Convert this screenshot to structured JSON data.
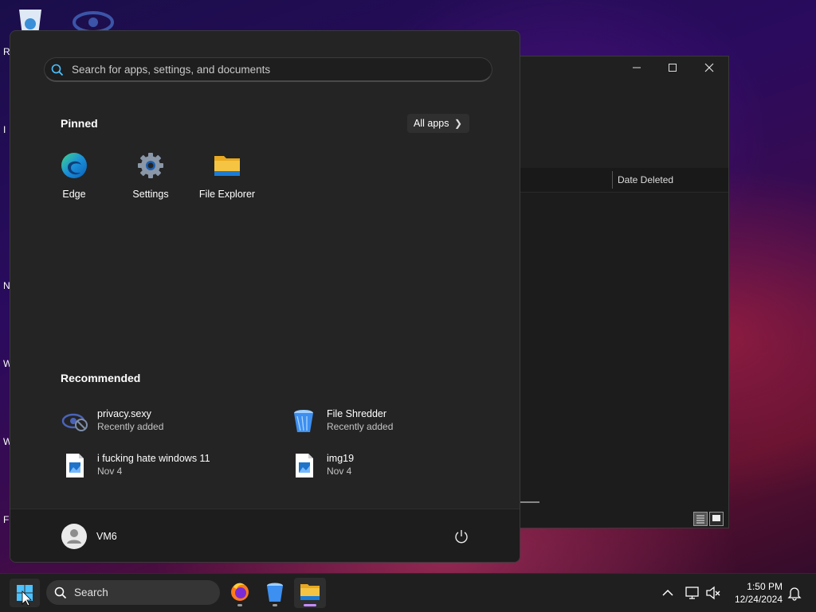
{
  "desktop": {
    "partial_labels": [
      "R",
      "I",
      "N",
      "W",
      "W",
      "Fi"
    ]
  },
  "background_window": {
    "column_header": "Date Deleted",
    "controls": [
      "minimize",
      "maximize",
      "close"
    ]
  },
  "start_menu": {
    "search_placeholder": "Search for apps, settings, and documents",
    "pinned_title": "Pinned",
    "all_apps_label": "All apps",
    "pinned": [
      {
        "label": "Edge",
        "icon": "edge-icon"
      },
      {
        "label": "Settings",
        "icon": "settings-gear-icon"
      },
      {
        "label": "File Explorer",
        "icon": "folder-icon"
      }
    ],
    "recommended_title": "Recommended",
    "recommended": [
      {
        "name": "privacy.sexy",
        "sub": "Recently added",
        "icon": "privacy-eye-icon"
      },
      {
        "name": "File Shredder",
        "sub": "Recently added",
        "icon": "shredder-bin-icon"
      },
      {
        "name": "i fucking hate windows 11",
        "sub": "Nov 4",
        "icon": "image-file-icon"
      },
      {
        "name": "img19",
        "sub": "Nov 4",
        "icon": "image-file-icon"
      }
    ],
    "user_name": "VM6"
  },
  "taskbar": {
    "search_label": "Search",
    "apps": [
      "firefox",
      "file-shredder",
      "file-explorer"
    ],
    "time": "1:50 PM",
    "date": "12/24/2024"
  },
  "colors": {
    "accent": "#c68cff",
    "edge_blue": "#1b8fd8",
    "folder_yellow": "#f6c443"
  }
}
